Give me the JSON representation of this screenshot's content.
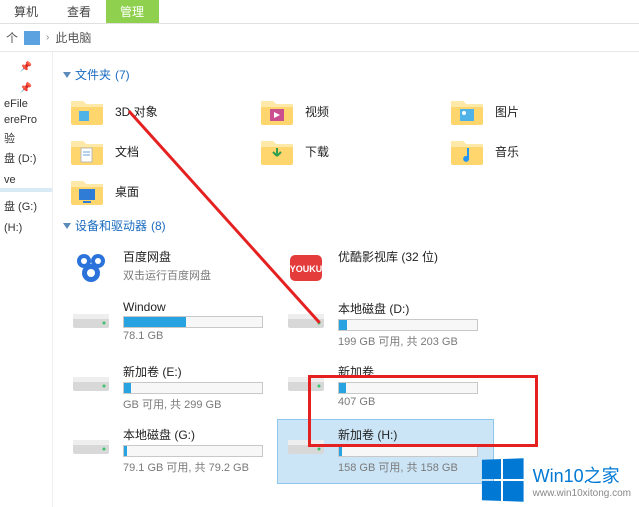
{
  "tabs": {
    "t0": "算机",
    "t1": "查看",
    "t2": "管理"
  },
  "breadcrumb": {
    "up": "个",
    "root": "此电脑"
  },
  "sidebar": {
    "items": [
      "",
      "eFile",
      "erePro",
      "验",
      "盘 (D:)",
      "",
      "ve",
      "",
      "",
      "盘 (G:)",
      "",
      "(H:)"
    ]
  },
  "sections": {
    "folders": {
      "title": "文件夹",
      "count": "(7)"
    },
    "drives": {
      "title": "设备和驱动器",
      "count": "(8)"
    }
  },
  "folders": [
    {
      "label": "3D 对象",
      "icon": "folder-3d"
    },
    {
      "label": "视频",
      "icon": "folder-video"
    },
    {
      "label": "图片",
      "icon": "folder-pictures"
    },
    {
      "label": "文档",
      "icon": "folder-docs"
    },
    {
      "label": "下载",
      "icon": "folder-downloads"
    },
    {
      "label": "音乐",
      "icon": "folder-music"
    },
    {
      "label": "桌面",
      "icon": "folder-desktop"
    }
  ],
  "drives": [
    {
      "title": "百度网盘",
      "sub": "双击运行百度网盘",
      "icon": "baidu",
      "bar": null
    },
    {
      "title": "优酷影视库 (32 位)",
      "sub": "",
      "icon": "youku",
      "bar": null
    },
    {
      "title": "Window",
      "sub": "78.1 GB",
      "icon": "hdd",
      "bar": 45
    },
    {
      "title": "本地磁盘 (D:)",
      "sub": "199 GB 可用, 共 203 GB",
      "icon": "hdd",
      "bar": 6
    },
    {
      "title": "新加卷 (E:)",
      "sub": "GB 可用, 共 299 GB",
      "icon": "hdd",
      "bar": 5
    },
    {
      "title": "新加卷",
      "sub": "407 GB",
      "icon": "hdd",
      "bar": 5
    },
    {
      "title": "本地磁盘 (G:)",
      "sub": "79.1 GB 可用, 共 79.2 GB",
      "icon": "hdd",
      "bar": 2
    },
    {
      "title": "新加卷 (H:)",
      "sub": "158 GB 可用, 共 158 GB",
      "icon": "hdd",
      "bar": 2,
      "selected": true
    }
  ],
  "watermark": {
    "brand": "Win10之家",
    "url": "www.win10xitong.com"
  }
}
